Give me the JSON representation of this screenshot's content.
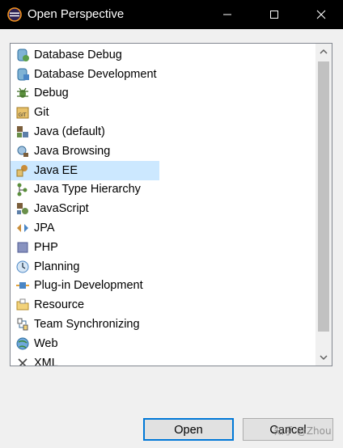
{
  "window": {
    "title": "Open Perspective"
  },
  "perspectives": [
    {
      "label": "Database Debug",
      "icon": "database-debug-icon"
    },
    {
      "label": "Database Development",
      "icon": "database-development-icon"
    },
    {
      "label": "Debug",
      "icon": "debug-bug-icon"
    },
    {
      "label": "Git",
      "icon": "git-icon"
    },
    {
      "label": "Java (default)",
      "icon": "java-icon"
    },
    {
      "label": "Java Browsing",
      "icon": "java-browsing-icon"
    },
    {
      "label": "Java EE",
      "icon": "java-ee-icon",
      "selected": true
    },
    {
      "label": "Java Type Hierarchy",
      "icon": "type-hierarchy-icon"
    },
    {
      "label": "JavaScript",
      "icon": "javascript-icon"
    },
    {
      "label": "JPA",
      "icon": "jpa-icon"
    },
    {
      "label": "PHP",
      "icon": "php-icon"
    },
    {
      "label": "Planning",
      "icon": "planning-clock-icon"
    },
    {
      "label": "Plug-in Development",
      "icon": "plugin-icon"
    },
    {
      "label": "Resource",
      "icon": "resource-folder-icon"
    },
    {
      "label": "Team Synchronizing",
      "icon": "team-sync-icon"
    },
    {
      "label": "Web",
      "icon": "web-globe-icon"
    },
    {
      "label": "XML",
      "icon": "xml-icon"
    }
  ],
  "buttons": {
    "open": "Open",
    "cancel": "Cancel"
  },
  "watermark": "知乎 @Zhou",
  "colors": {
    "selection": "#cce8ff",
    "focus_border": "#0078d7",
    "titlebar": "#000000"
  }
}
